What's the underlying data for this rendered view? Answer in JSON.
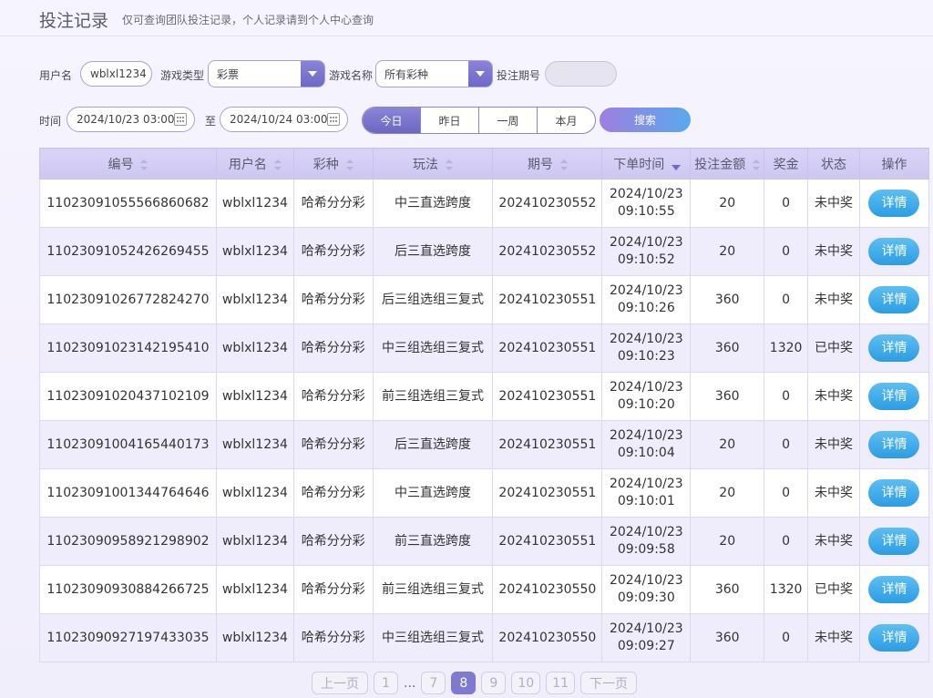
{
  "header": {
    "title": "投注记录",
    "subtitle": "仅可查询团队投注记录，个人记录请到个人中心查询"
  },
  "filters": {
    "username_label": "用户名",
    "username_value": "wblxl1234",
    "game_type_label": "游戏类型",
    "game_type_value": "彩票",
    "game_name_label": "游戏名称",
    "game_name_value": "所有彩种",
    "period_label": "投注期号",
    "period_value": "",
    "time_label": "时间",
    "start_date": "2024/10/23 03:00",
    "to_label": "至",
    "end_date": "2024/10/24 03:00",
    "quick_ranges": [
      "今日",
      "昨日",
      "一周",
      "本月"
    ],
    "active_range": "今日",
    "search_label": "搜索"
  },
  "table": {
    "columns": [
      "编号",
      "用户名",
      "彩种",
      "玩法",
      "期号",
      "下单时间",
      "投注金额",
      "奖金",
      "状态",
      "操作"
    ],
    "rows": [
      {
        "id": "110230910555668606 82",
        "user": "wblxl1234",
        "lottery": "哈希分分彩",
        "play": "中三直选跨度",
        "period": "202410230552",
        "date": "2024/10/23",
        "time": "09:10:55",
        "amount": "20",
        "prize": "0",
        "status": "未中奖",
        "action": "详情"
      },
      {
        "id": "11023091052426269455",
        "user": "wblxl1234",
        "lottery": "哈希分分彩",
        "play": "后三直选跨度",
        "period": "202410230552",
        "date": "2024/10/23",
        "time": "09:10:52",
        "amount": "20",
        "prize": "0",
        "status": "未中奖",
        "action": "详情"
      },
      {
        "id": "11023091026772824270",
        "user": "wblxl1234",
        "lottery": "哈希分分彩",
        "play": "后三组选组三复式",
        "period": "202410230551",
        "date": "2024/10/23",
        "time": "09:10:26",
        "amount": "360",
        "prize": "0",
        "status": "未中奖",
        "action": "详情"
      },
      {
        "id": "11023091023142195410",
        "user": "wblxl1234",
        "lottery": "哈希分分彩",
        "play": "中三组选组三复式",
        "period": "202410230551",
        "date": "2024/10/23",
        "time": "09:10:23",
        "amount": "360",
        "prize": "1320",
        "status": "已中奖",
        "action": "详情"
      },
      {
        "id": "11023091020437102109",
        "user": "wblxl1234",
        "lottery": "哈希分分彩",
        "play": "前三组选组三复式",
        "period": "202410230551",
        "date": "2024/10/23",
        "time": "09:10:20",
        "amount": "360",
        "prize": "0",
        "status": "未中奖",
        "action": "详情"
      },
      {
        "id": "11023091004165440173",
        "user": "wblxl1234",
        "lottery": "哈希分分彩",
        "play": "后三直选跨度",
        "period": "202410230551",
        "date": "2024/10/23",
        "time": "09:10:04",
        "amount": "20",
        "prize": "0",
        "status": "未中奖",
        "action": "详情"
      },
      {
        "id": "11023091001344764646",
        "user": "wblxl1234",
        "lottery": "哈希分分彩",
        "play": "中三直选跨度",
        "period": "202410230551",
        "date": "2024/10/23",
        "time": "09:10:01",
        "amount": "20",
        "prize": "0",
        "status": "未中奖",
        "action": "详情"
      },
      {
        "id": "11023090958921298902",
        "user": "wblxl1234",
        "lottery": "哈希分分彩",
        "play": "前三直选跨度",
        "period": "202410230551",
        "date": "2024/10/23",
        "time": "09:09:58",
        "amount": "20",
        "prize": "0",
        "status": "未中奖",
        "action": "详情"
      },
      {
        "id": "11023090930884266725",
        "user": "wblxl1234",
        "lottery": "哈希分分彩",
        "play": "前三组选组三复式",
        "period": "202410230550",
        "date": "2024/10/23",
        "time": "09:09:30",
        "amount": "360",
        "prize": "1320",
        "status": "已中奖",
        "action": "详情"
      },
      {
        "id": "11023090927197433035",
        "user": "wblxl1234",
        "lottery": "哈希分分彩",
        "play": "中三组选组三复式",
        "period": "202410230550",
        "date": "2024/10/23",
        "time": "09:09:27",
        "amount": "360",
        "prize": "0",
        "status": "未中奖",
        "action": "详情"
      }
    ]
  },
  "pagination": {
    "prev_label": "上一页",
    "next_label": "下一页",
    "first": "1",
    "ellipsis": "...",
    "pages": [
      "7",
      "8",
      "9",
      "10",
      "11"
    ],
    "current": "8"
  },
  "colors": {
    "accent": "#7f79d0",
    "won": "#e0413e",
    "detail_button": "#2b9de3"
  }
}
